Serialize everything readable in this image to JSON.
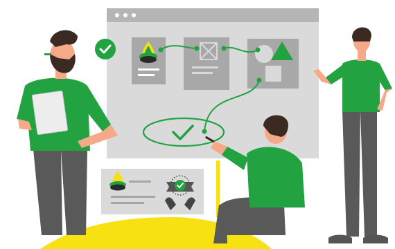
{
  "illustration": {
    "theme": "team reviewing a design workflow on a browser mockup",
    "browser_window": {
      "window_dots": [
        "dot",
        "dot",
        "dot"
      ],
      "cards": [
        {
          "name": "logo-card",
          "icon": "drop-logo-icon"
        },
        {
          "name": "image-placeholder-card",
          "icon": "image-placeholder-icon"
        },
        {
          "name": "shapes-card",
          "icon": "shapes-icon"
        }
      ],
      "goal": {
        "icon": "check-icon",
        "state": "completed"
      }
    },
    "approval_badge": {
      "icon": "check-circle-icon",
      "state": "approved"
    },
    "brand_card": {
      "icons": [
        "drop-logo-icon",
        "certified-badge-icon",
        "hands-icon"
      ]
    },
    "people": [
      "man-with-tablet",
      "woman-pointing",
      "man-kneeling-drawing"
    ]
  },
  "colors": {
    "accent_green": "#22a240",
    "pole_yellow": "#f8e112",
    "window_gray": "#d9d9d9",
    "titlebar_gray": "#b3b3b3",
    "card_gray": "#a6a6a6",
    "skin": "#f5a989",
    "hair_dark": "#3a2a22",
    "pants_gray": "#595959"
  }
}
